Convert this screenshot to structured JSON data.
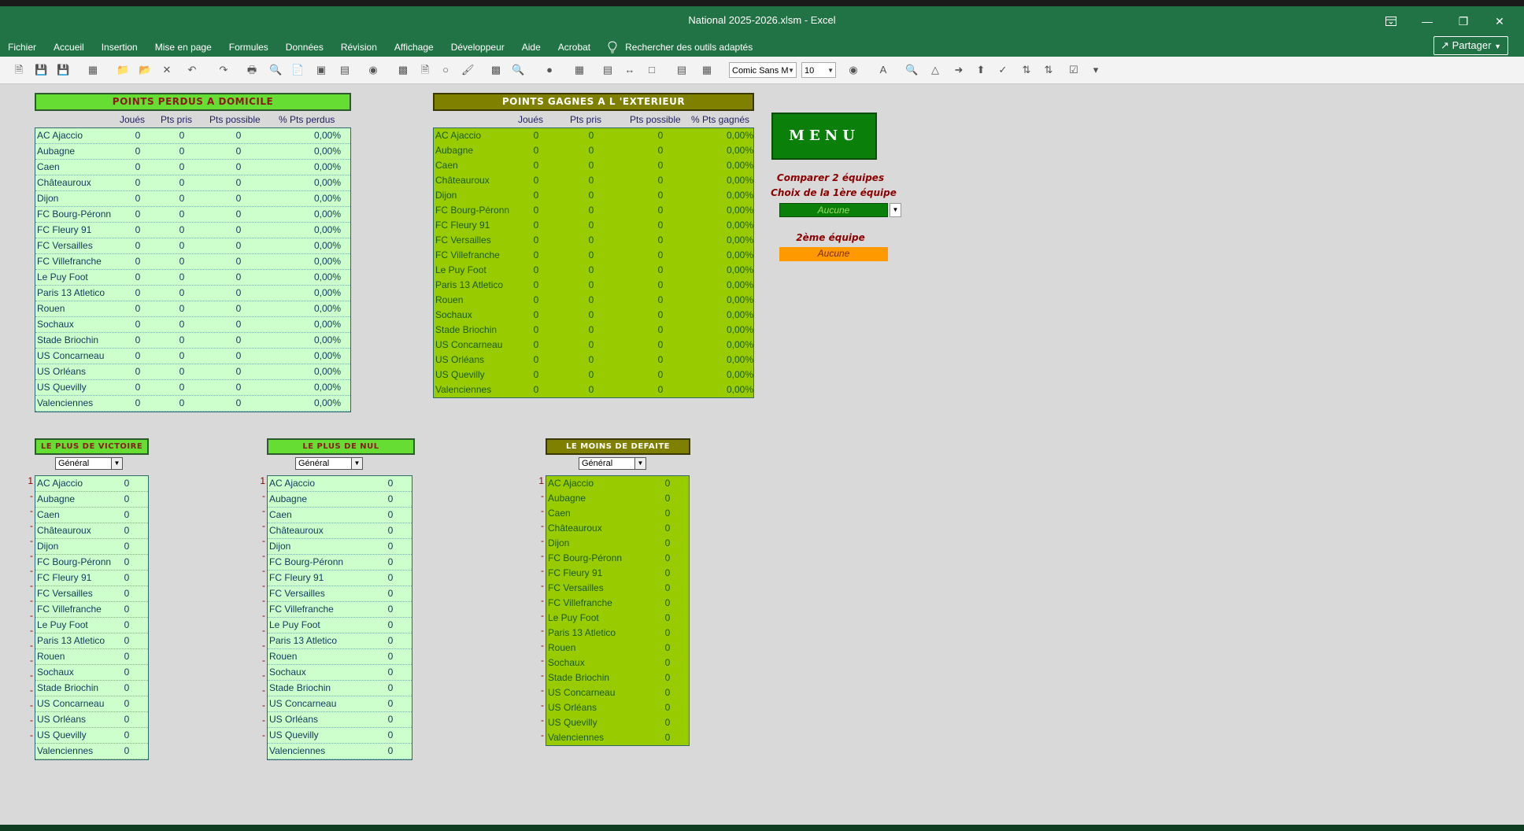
{
  "window": {
    "title": "National 2025-2026.xlsm  -  Excel",
    "controls": [
      "restore-layout",
      "minimize",
      "maximize",
      "close"
    ]
  },
  "menu": {
    "items": [
      "Fichier",
      "Accueil",
      "Insertion",
      "Mise en page",
      "Formules",
      "Données",
      "Révision",
      "Affichage",
      "Développeur",
      "Aide",
      "Acrobat"
    ],
    "tell_me": "Rechercher des outils adaptés",
    "share": "Partager"
  },
  "toolbar": {
    "font_name": "Comic Sans M",
    "font_size": "10"
  },
  "home_table": {
    "title": "POINTS PERDUS A DOMICILE",
    "columns": [
      "Joués",
      "Pts pris",
      "Pts possible",
      "% Pts perdus"
    ]
  },
  "away_table": {
    "title": "POINTS GAGNES A L 'EXTERIEUR",
    "columns": [
      "Joués",
      "Pts pris",
      "Pts possible",
      "% Pts gagnés"
    ]
  },
  "teams": [
    "AC Ajaccio",
    "Aubagne",
    "Caen",
    "Châteauroux",
    "Dijon",
    "FC Bourg-Péronn",
    "FC Fleury 91",
    "FC Versailles",
    "FC Villefranche",
    "Le Puy Foot",
    "Paris 13 Atletico",
    "Rouen",
    "Sochaux",
    "Stade Briochin",
    "US Concarneau",
    "US Orléans",
    "US Quevilly",
    "Valenciennes"
  ],
  "row_values": {
    "played": "0",
    "pts_taken": "0",
    "pts_possible": "0",
    "pct": "0,00%",
    "count": "0"
  },
  "menu_button": "MENU",
  "compare": {
    "title": "Comparer 2 équipes",
    "first_label": "Choix de la 1ère équipe",
    "first_value": "Aucune",
    "second_label": "2ème équipe",
    "second_value": "Aucune"
  },
  "rank_tables": [
    {
      "title": "LE PLUS DE VICTOIRE",
      "filter": "Général",
      "style": "light"
    },
    {
      "title": "LE PLUS DE NUL",
      "filter": "Général",
      "style": "light"
    },
    {
      "title": "LE MOINS DE DEFAITE",
      "filter": "Général",
      "style": "olive"
    }
  ],
  "rank_markers": [
    "1",
    "-",
    "-",
    "-",
    "-",
    "-",
    "-",
    "-",
    "-",
    "-",
    "-",
    "-",
    "-",
    "-",
    "-",
    "-",
    "-",
    "-"
  ]
}
